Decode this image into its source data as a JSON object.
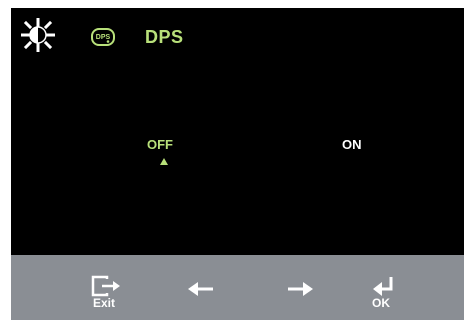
{
  "menu": {
    "title": "DPS",
    "icons": {
      "category": "brightness-icon",
      "item": "dps-icon"
    }
  },
  "options": {
    "off_label": "OFF",
    "on_label": "ON",
    "selected": "OFF"
  },
  "controls": {
    "exit_label": "Exit",
    "left_icon": "left-arrow-icon",
    "right_icon": "right-arrow-icon",
    "ok_label": "OK"
  },
  "colors": {
    "background": "#000000",
    "accent": "#b8e07a",
    "text": "#ffffff",
    "bar": "#8a8e94"
  }
}
